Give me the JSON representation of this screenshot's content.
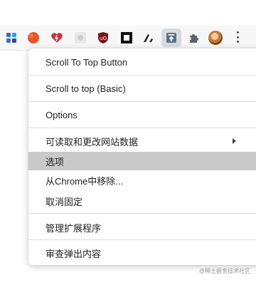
{
  "toolbar": {
    "icons": [
      {
        "name": "grid-extension-icon",
        "color": "#3b6cc7"
      },
      {
        "name": "orange-blob-extension-icon",
        "color": "#e8542a"
      },
      {
        "name": "heart-extension-icon",
        "color": "#c8343d"
      },
      {
        "name": "gray-square-extension-icon",
        "color": "#cfcfcf"
      },
      {
        "name": "ublock-origin-icon",
        "color": "#7b1416"
      },
      {
        "name": "square-frame-extension-icon",
        "color": "#111111"
      },
      {
        "name": "pen-extension-icon",
        "color": "#222222"
      },
      {
        "name": "scroll-to-top-extension-icon",
        "color": "#5a6f86"
      },
      {
        "name": "puzzle-extensions-icon",
        "color": "#5f6368"
      }
    ]
  },
  "menu": {
    "items": [
      {
        "label": "Scroll To Top Button"
      },
      {
        "label": "Scroll to top (Basic)"
      },
      {
        "label": "Options"
      },
      {
        "label": "可读取和更改网站数据"
      },
      {
        "label": "选项"
      },
      {
        "label": "从Chrome中移除..."
      },
      {
        "label": "取消固定"
      },
      {
        "label": "管理扩展程序"
      },
      {
        "label": "审查弹出内容"
      }
    ]
  },
  "watermark": "@稀土掘金技术社区"
}
